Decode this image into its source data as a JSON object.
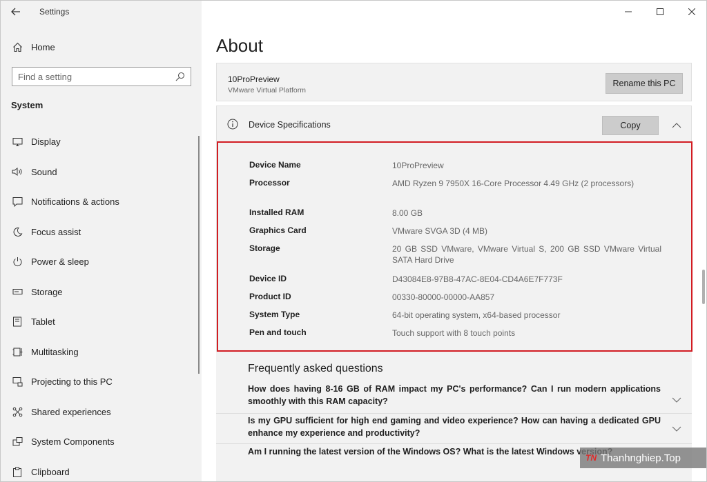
{
  "window": {
    "title": "Settings"
  },
  "sidebar": {
    "home_label": "Home",
    "search_placeholder": "Find a setting",
    "section_label": "System",
    "items": [
      {
        "label": "Display",
        "icon": "monitor-icon"
      },
      {
        "label": "Sound",
        "icon": "speaker-icon"
      },
      {
        "label": "Notifications & actions",
        "icon": "notification-icon"
      },
      {
        "label": "Focus assist",
        "icon": "moon-icon"
      },
      {
        "label": "Power & sleep",
        "icon": "power-icon"
      },
      {
        "label": "Storage",
        "icon": "drive-icon"
      },
      {
        "label": "Tablet",
        "icon": "tablet-icon"
      },
      {
        "label": "Multitasking",
        "icon": "multitasking-icon"
      },
      {
        "label": "Projecting to this PC",
        "icon": "projecting-icon"
      },
      {
        "label": "Shared experiences",
        "icon": "shared-icon"
      },
      {
        "label": "System Components",
        "icon": "components-icon"
      },
      {
        "label": "Clipboard",
        "icon": "clipboard-icon"
      }
    ]
  },
  "main": {
    "page_title": "About",
    "pc_card": {
      "name": "10ProPreview",
      "platform": "VMware Virtual Platform",
      "rename_label": "Rename this PC"
    },
    "specs": {
      "title": "Device Specifications",
      "copy_label": "Copy",
      "rows": [
        {
          "label": "Device Name",
          "value": "10ProPreview"
        },
        {
          "label": "Processor",
          "value": "AMD Ryzen 9 7950X 16-Core Processor 4.49 GHz (2 processors)"
        },
        {
          "label": "Installed RAM",
          "value": "8.00 GB"
        },
        {
          "label": "Graphics Card",
          "value": "VMware SVGA 3D (4 MB)"
        },
        {
          "label": "Storage",
          "value": "20 GB SSD VMware, VMware Virtual S, 200 GB SSD VMware Virtual SATA Hard Drive"
        },
        {
          "label": "Device ID",
          "value": "D43084E8-97B8-47AC-8E04-CD4A6E7F773F"
        },
        {
          "label": "Product ID",
          "value": "00330-80000-00000-AA857"
        },
        {
          "label": "System Type",
          "value": "64-bit operating system, x64-based processor"
        },
        {
          "label": "Pen and touch",
          "value": "Touch support with 8 touch points"
        }
      ]
    },
    "faq": {
      "title": "Frequently asked questions",
      "items": [
        {
          "question": "How does having 8-16 GB of RAM impact my PC's performance? Can I run modern applications smoothly with this RAM capacity?"
        },
        {
          "question": "Is my GPU sufficient for high end gaming and video experience? How can having a dedicated GPU enhance my experience and productivity?"
        },
        {
          "question": "Am I running the latest version of the Windows OS? What is the latest Windows version?"
        }
      ]
    }
  },
  "watermark": {
    "logo": "TN",
    "text": "Thanhnghiep.Top"
  },
  "colors": {
    "highlight": "#d21c22",
    "sidebar_bg": "#f2f2f2",
    "card_bg": "#f2f2f2",
    "button_bg": "#cccccc"
  }
}
